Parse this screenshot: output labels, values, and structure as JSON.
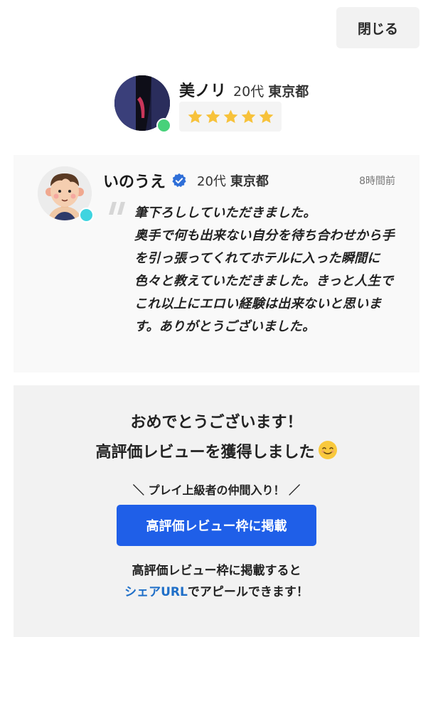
{
  "close_button": {
    "label": "閉じる"
  },
  "profile": {
    "name": "美ノリ",
    "age": "20代",
    "prefecture": "東京都",
    "rating": 5,
    "online_color": "#47d17a"
  },
  "review": {
    "reviewer_name": "いのうえ",
    "age": "20代",
    "prefecture": "東京都",
    "time_ago": "8時間前",
    "verified_color": "#2f6fd8",
    "online_color": "#3fd4e0",
    "text": "筆下ろししていただきました。\n奥手で何も出来ない自分を待ち合わせから手を引っ張ってくれてホテルに入った瞬間に色々と教えていただきました。きっと人生でこれ以上にエロい経験は出来ないと思います。ありがとうございました。"
  },
  "promo": {
    "congrats_line1": "おめでとうございます！",
    "congrats_line2": "高評価レビューを獲得しました",
    "tagline": "＼ プレイ上級者の仲間入り！ ／",
    "button_label": "高評価レビュー枠に掲載",
    "note_line1": "高評価レビュー枠に掲載すると",
    "note_link": "シェアURL",
    "note_rest": "でアピールできます！",
    "accent_color": "#1f5fe8"
  }
}
